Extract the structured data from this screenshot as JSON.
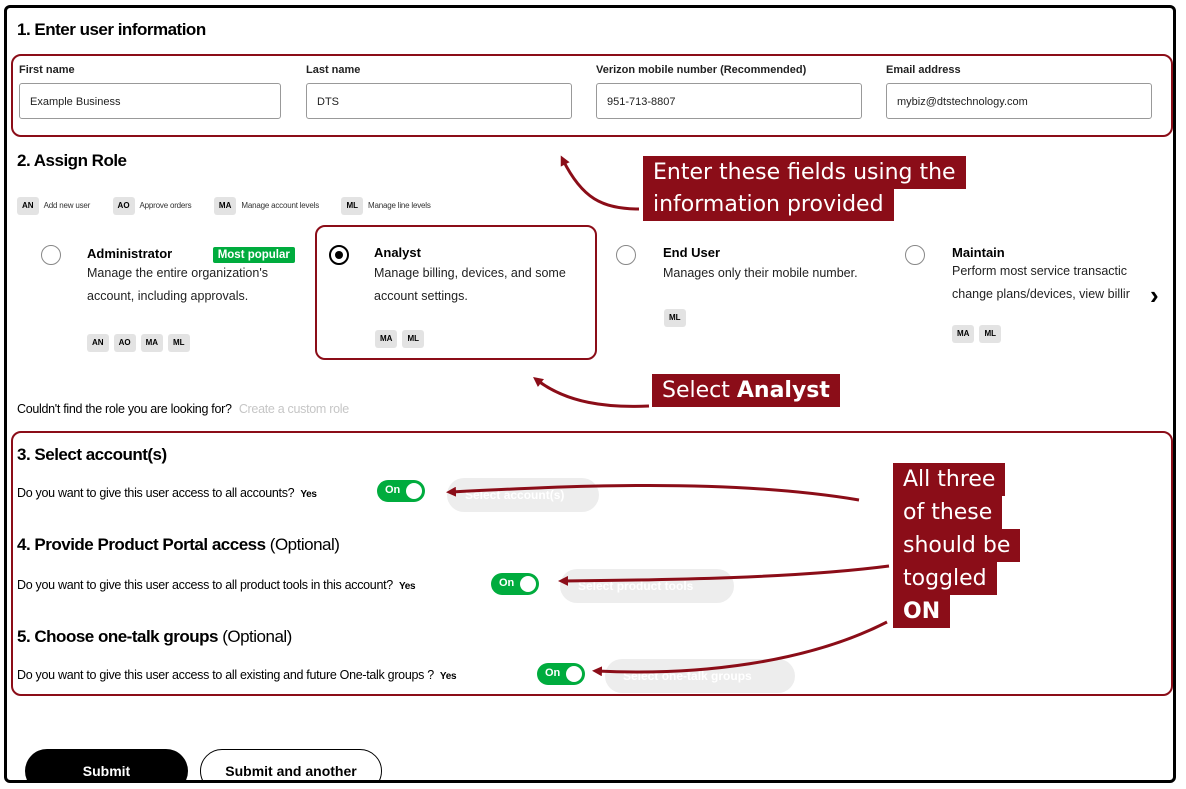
{
  "section1": {
    "title": "1. Enter user information",
    "fields": [
      {
        "label": "First name",
        "value": "Example Business"
      },
      {
        "label": "Last name",
        "value": "DTS"
      },
      {
        "label": "Verizon mobile number (Recommended)",
        "value": "951-713-8807"
      },
      {
        "label": "Email address",
        "value": "mybiz@dtstechnology.com"
      }
    ]
  },
  "section2": {
    "title": "2. Assign Role",
    "legend": [
      {
        "code": "AN",
        "text": "Add new user"
      },
      {
        "code": "AO",
        "text": "Approve orders"
      },
      {
        "code": "MA",
        "text": "Manage account levels"
      },
      {
        "code": "ML",
        "text": "Manage line levels"
      }
    ],
    "roles": [
      {
        "title": "Administrator",
        "badge": "Most popular",
        "desc1": "Manage the entire organization's",
        "desc2": "account, including approvals.",
        "chips": [
          "AN",
          "AO",
          "MA",
          "ML"
        ],
        "selected": false
      },
      {
        "title": "Analyst",
        "desc1": "Manage billing, devices, and some",
        "desc2": "account settings.",
        "chips": [
          "MA",
          "ML"
        ],
        "selected": true
      },
      {
        "title": "End User",
        "desc1": "Manages only their mobile number.",
        "chips": [
          "ML"
        ],
        "selected": false
      },
      {
        "title": "Maintain",
        "desc1": "Perform most service transactic",
        "desc2": "change plans/devices, view billir",
        "chips": [
          "MA",
          "ML"
        ],
        "selected": false
      }
    ],
    "next_arrow": "›",
    "custom_prompt": "Couldn't find the role you are looking for?",
    "custom_link": "Create a custom role"
  },
  "section3": {
    "title": "3. Select account(s)",
    "question": "Do you want to give this user access to all accounts?",
    "yes": "Yes",
    "toggle": "On",
    "button": "Select account(s)"
  },
  "section4": {
    "title": "4. Provide Product Portal access",
    "optional": " (Optional)",
    "question": "Do you want to give this user access to all product tools in this account?",
    "yes": "Yes",
    "toggle": "On",
    "button": "Select product tools"
  },
  "section5": {
    "title": "5. Choose one-talk groups",
    "optional": " (Optional)",
    "question": "Do you want to give this user access to all existing and future One-talk groups ?",
    "yes": "Yes",
    "toggle": "On",
    "button": "Select one-talk groups"
  },
  "buttons": {
    "submit": "Submit",
    "submit_another": "Submit and another"
  },
  "callouts": {
    "fields_line1": "Enter these fields using the",
    "fields_line2": "information provided",
    "analyst_prefix": "Select ",
    "analyst_bold": "Analyst",
    "toggle_lines": [
      "All three",
      "of these",
      "should be",
      "toggled"
    ],
    "toggle_bold": "ON"
  },
  "colors": {
    "accent_red": "#8b0d18",
    "toggle_green": "#00ac3e"
  }
}
